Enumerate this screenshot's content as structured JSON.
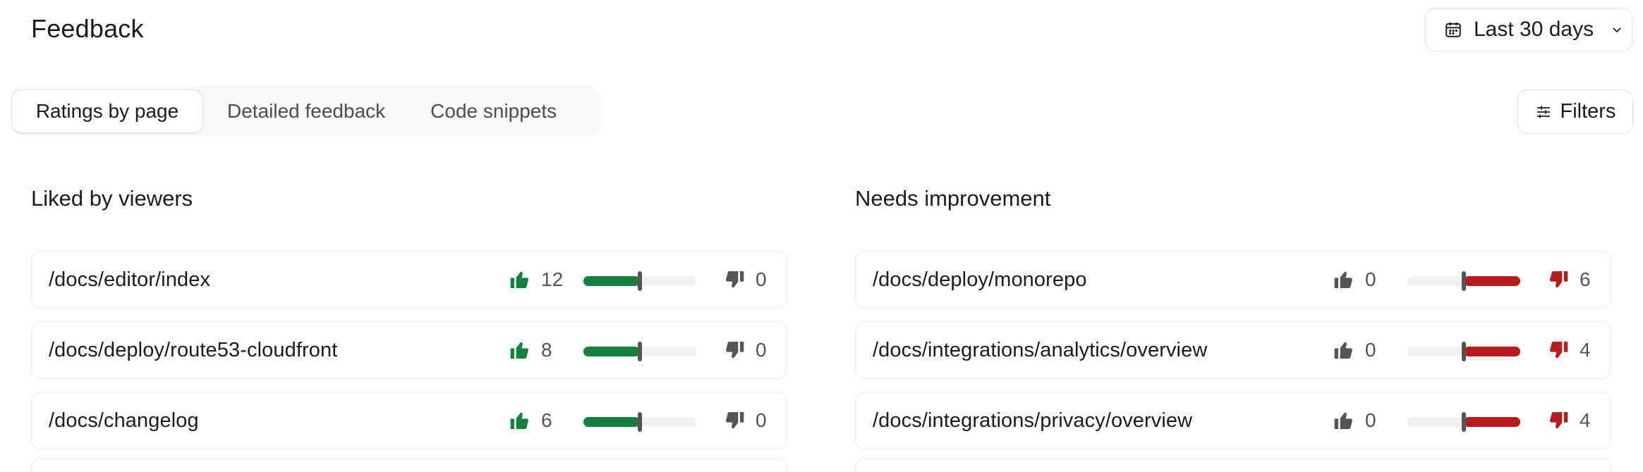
{
  "header": {
    "title": "Feedback",
    "date_range": "Last 30 days"
  },
  "tabs": [
    {
      "label": "Ratings by page",
      "active": true
    },
    {
      "label": "Detailed feedback",
      "active": false
    },
    {
      "label": "Code snippets",
      "active": false
    }
  ],
  "filters_label": "Filters",
  "liked": {
    "title": "Liked by viewers",
    "rows": [
      {
        "path": "/docs/editor/index",
        "likes": "12",
        "dislikes": "0",
        "like_ratio": 1.0
      },
      {
        "path": "/docs/deploy/route53-cloudfront",
        "likes": "8",
        "dislikes": "0",
        "like_ratio": 1.0
      },
      {
        "path": "/docs/changelog",
        "likes": "6",
        "dislikes": "0",
        "like_ratio": 1.0
      }
    ]
  },
  "needs": {
    "title": "Needs improvement",
    "rows": [
      {
        "path": "/docs/deploy/monorepo",
        "likes": "0",
        "dislikes": "6",
        "like_ratio": 0.0
      },
      {
        "path": "/docs/integrations/analytics/overview",
        "likes": "0",
        "dislikes": "4",
        "like_ratio": 0.0
      },
      {
        "path": "/docs/integrations/privacy/overview",
        "likes": "0",
        "dislikes": "4",
        "like_ratio": 0.0
      }
    ]
  },
  "colors": {
    "positive": "#15803d",
    "negative": "#b91c1c",
    "neutral_icon": "#555555"
  }
}
